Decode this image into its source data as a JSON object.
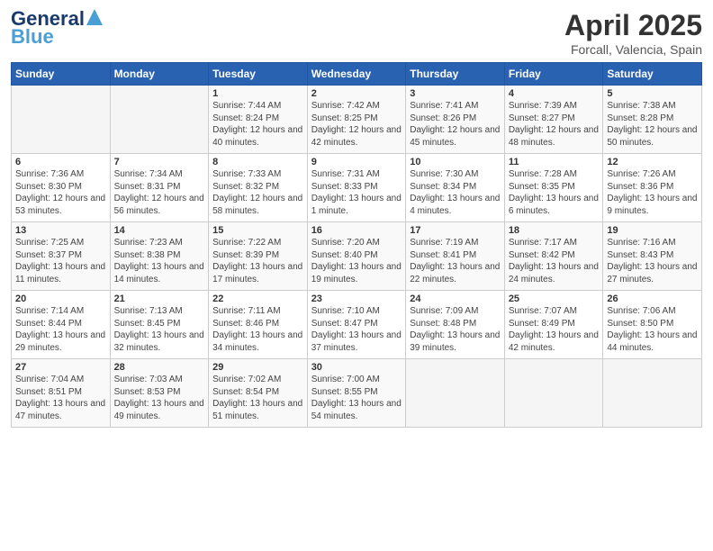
{
  "header": {
    "logo_line1": "General",
    "logo_line2": "Blue",
    "title": "April 2025",
    "location": "Forcall, Valencia, Spain"
  },
  "days_of_week": [
    "Sunday",
    "Monday",
    "Tuesday",
    "Wednesday",
    "Thursday",
    "Friday",
    "Saturday"
  ],
  "weeks": [
    [
      {
        "day": "",
        "sunrise": "",
        "sunset": "",
        "daylight": ""
      },
      {
        "day": "",
        "sunrise": "",
        "sunset": "",
        "daylight": ""
      },
      {
        "day": "1",
        "sunrise": "Sunrise: 7:44 AM",
        "sunset": "Sunset: 8:24 PM",
        "daylight": "Daylight: 12 hours and 40 minutes."
      },
      {
        "day": "2",
        "sunrise": "Sunrise: 7:42 AM",
        "sunset": "Sunset: 8:25 PM",
        "daylight": "Daylight: 12 hours and 42 minutes."
      },
      {
        "day": "3",
        "sunrise": "Sunrise: 7:41 AM",
        "sunset": "Sunset: 8:26 PM",
        "daylight": "Daylight: 12 hours and 45 minutes."
      },
      {
        "day": "4",
        "sunrise": "Sunrise: 7:39 AM",
        "sunset": "Sunset: 8:27 PM",
        "daylight": "Daylight: 12 hours and 48 minutes."
      },
      {
        "day": "5",
        "sunrise": "Sunrise: 7:38 AM",
        "sunset": "Sunset: 8:28 PM",
        "daylight": "Daylight: 12 hours and 50 minutes."
      }
    ],
    [
      {
        "day": "6",
        "sunrise": "Sunrise: 7:36 AM",
        "sunset": "Sunset: 8:30 PM",
        "daylight": "Daylight: 12 hours and 53 minutes."
      },
      {
        "day": "7",
        "sunrise": "Sunrise: 7:34 AM",
        "sunset": "Sunset: 8:31 PM",
        "daylight": "Daylight: 12 hours and 56 minutes."
      },
      {
        "day": "8",
        "sunrise": "Sunrise: 7:33 AM",
        "sunset": "Sunset: 8:32 PM",
        "daylight": "Daylight: 12 hours and 58 minutes."
      },
      {
        "day": "9",
        "sunrise": "Sunrise: 7:31 AM",
        "sunset": "Sunset: 8:33 PM",
        "daylight": "Daylight: 13 hours and 1 minute."
      },
      {
        "day": "10",
        "sunrise": "Sunrise: 7:30 AM",
        "sunset": "Sunset: 8:34 PM",
        "daylight": "Daylight: 13 hours and 4 minutes."
      },
      {
        "day": "11",
        "sunrise": "Sunrise: 7:28 AM",
        "sunset": "Sunset: 8:35 PM",
        "daylight": "Daylight: 13 hours and 6 minutes."
      },
      {
        "day": "12",
        "sunrise": "Sunrise: 7:26 AM",
        "sunset": "Sunset: 8:36 PM",
        "daylight": "Daylight: 13 hours and 9 minutes."
      }
    ],
    [
      {
        "day": "13",
        "sunrise": "Sunrise: 7:25 AM",
        "sunset": "Sunset: 8:37 PM",
        "daylight": "Daylight: 13 hours and 11 minutes."
      },
      {
        "day": "14",
        "sunrise": "Sunrise: 7:23 AM",
        "sunset": "Sunset: 8:38 PM",
        "daylight": "Daylight: 13 hours and 14 minutes."
      },
      {
        "day": "15",
        "sunrise": "Sunrise: 7:22 AM",
        "sunset": "Sunset: 8:39 PM",
        "daylight": "Daylight: 13 hours and 17 minutes."
      },
      {
        "day": "16",
        "sunrise": "Sunrise: 7:20 AM",
        "sunset": "Sunset: 8:40 PM",
        "daylight": "Daylight: 13 hours and 19 minutes."
      },
      {
        "day": "17",
        "sunrise": "Sunrise: 7:19 AM",
        "sunset": "Sunset: 8:41 PM",
        "daylight": "Daylight: 13 hours and 22 minutes."
      },
      {
        "day": "18",
        "sunrise": "Sunrise: 7:17 AM",
        "sunset": "Sunset: 8:42 PM",
        "daylight": "Daylight: 13 hours and 24 minutes."
      },
      {
        "day": "19",
        "sunrise": "Sunrise: 7:16 AM",
        "sunset": "Sunset: 8:43 PM",
        "daylight": "Daylight: 13 hours and 27 minutes."
      }
    ],
    [
      {
        "day": "20",
        "sunrise": "Sunrise: 7:14 AM",
        "sunset": "Sunset: 8:44 PM",
        "daylight": "Daylight: 13 hours and 29 minutes."
      },
      {
        "day": "21",
        "sunrise": "Sunrise: 7:13 AM",
        "sunset": "Sunset: 8:45 PM",
        "daylight": "Daylight: 13 hours and 32 minutes."
      },
      {
        "day": "22",
        "sunrise": "Sunrise: 7:11 AM",
        "sunset": "Sunset: 8:46 PM",
        "daylight": "Daylight: 13 hours and 34 minutes."
      },
      {
        "day": "23",
        "sunrise": "Sunrise: 7:10 AM",
        "sunset": "Sunset: 8:47 PM",
        "daylight": "Daylight: 13 hours and 37 minutes."
      },
      {
        "day": "24",
        "sunrise": "Sunrise: 7:09 AM",
        "sunset": "Sunset: 8:48 PM",
        "daylight": "Daylight: 13 hours and 39 minutes."
      },
      {
        "day": "25",
        "sunrise": "Sunrise: 7:07 AM",
        "sunset": "Sunset: 8:49 PM",
        "daylight": "Daylight: 13 hours and 42 minutes."
      },
      {
        "day": "26",
        "sunrise": "Sunrise: 7:06 AM",
        "sunset": "Sunset: 8:50 PM",
        "daylight": "Daylight: 13 hours and 44 minutes."
      }
    ],
    [
      {
        "day": "27",
        "sunrise": "Sunrise: 7:04 AM",
        "sunset": "Sunset: 8:51 PM",
        "daylight": "Daylight: 13 hours and 47 minutes."
      },
      {
        "day": "28",
        "sunrise": "Sunrise: 7:03 AM",
        "sunset": "Sunset: 8:53 PM",
        "daylight": "Daylight: 13 hours and 49 minutes."
      },
      {
        "day": "29",
        "sunrise": "Sunrise: 7:02 AM",
        "sunset": "Sunset: 8:54 PM",
        "daylight": "Daylight: 13 hours and 51 minutes."
      },
      {
        "day": "30",
        "sunrise": "Sunrise: 7:00 AM",
        "sunset": "Sunset: 8:55 PM",
        "daylight": "Daylight: 13 hours and 54 minutes."
      },
      {
        "day": "",
        "sunrise": "",
        "sunset": "",
        "daylight": ""
      },
      {
        "day": "",
        "sunrise": "",
        "sunset": "",
        "daylight": ""
      },
      {
        "day": "",
        "sunrise": "",
        "sunset": "",
        "daylight": ""
      }
    ]
  ]
}
